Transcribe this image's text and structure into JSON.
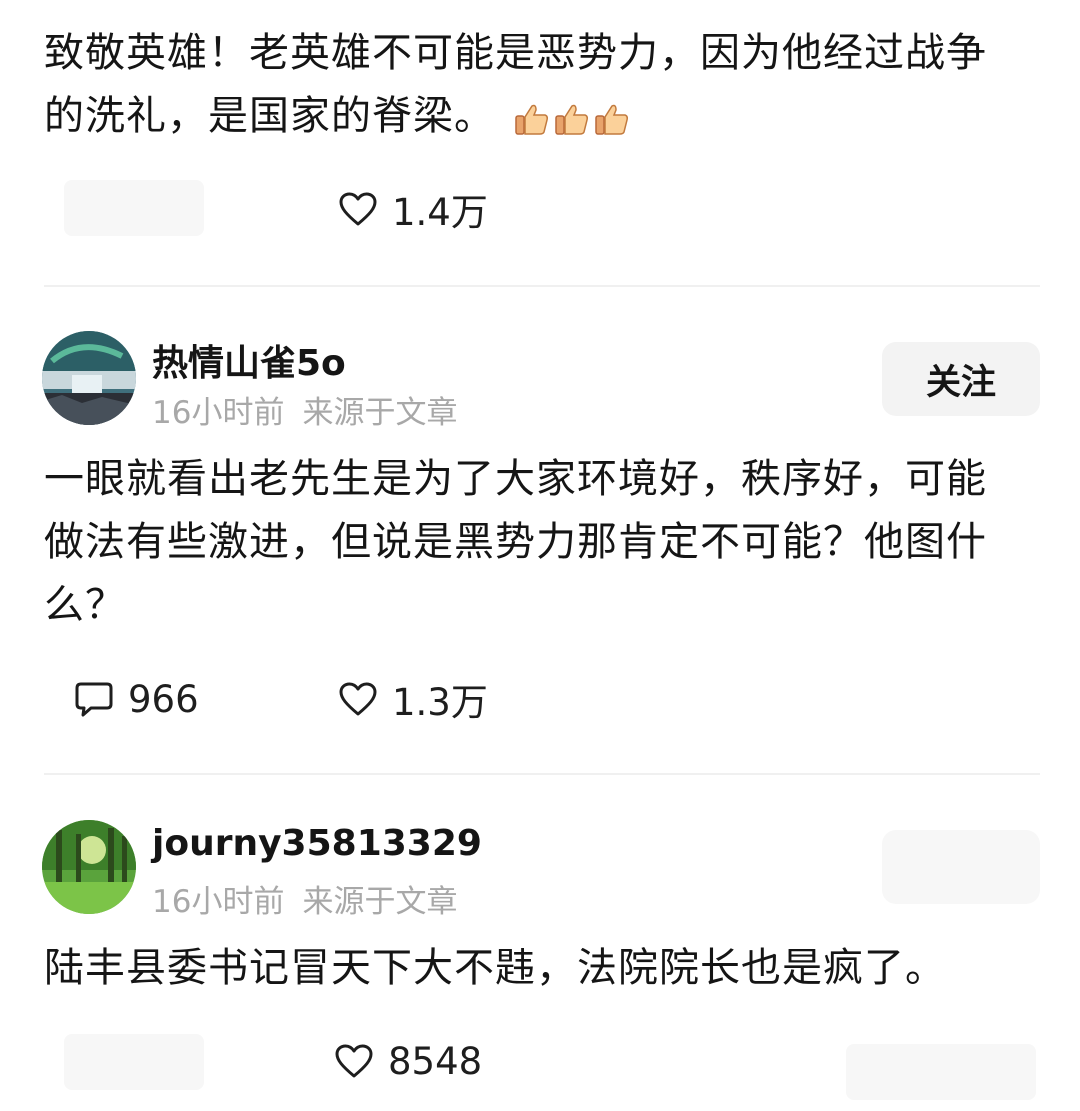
{
  "comments": [
    {
      "text": "致敬英雄！老英雄不可能是恶势力，因为他经过战争的洗礼，是国家的脊梁。",
      "likes": "1.4万"
    },
    {
      "username": "热情山雀5o",
      "time": "16小时前",
      "source": "来源于文章",
      "follow_label": "关注",
      "text": "一眼就看出老先生是为了大家环境好，秩序好，可能做法有些激进，但说是黑势力那肯定不可能？他图什么？",
      "replies": "966",
      "likes": "1.3万"
    },
    {
      "username": "journy35813329",
      "time": "16小时前",
      "source": "来源于文章",
      "text": "陆丰县委书记冒天下大不韪，法院院长也是疯了。",
      "likes": "8548"
    }
  ],
  "icons": {
    "like": "heart-outline-icon",
    "reply": "speech-bubble-icon",
    "emoji": "thumbs-up-emoji"
  },
  "colors": {
    "meta_text": "#a8a8a8",
    "follow_bg": "#f3f3f3",
    "divider": "#f0f0f0"
  }
}
